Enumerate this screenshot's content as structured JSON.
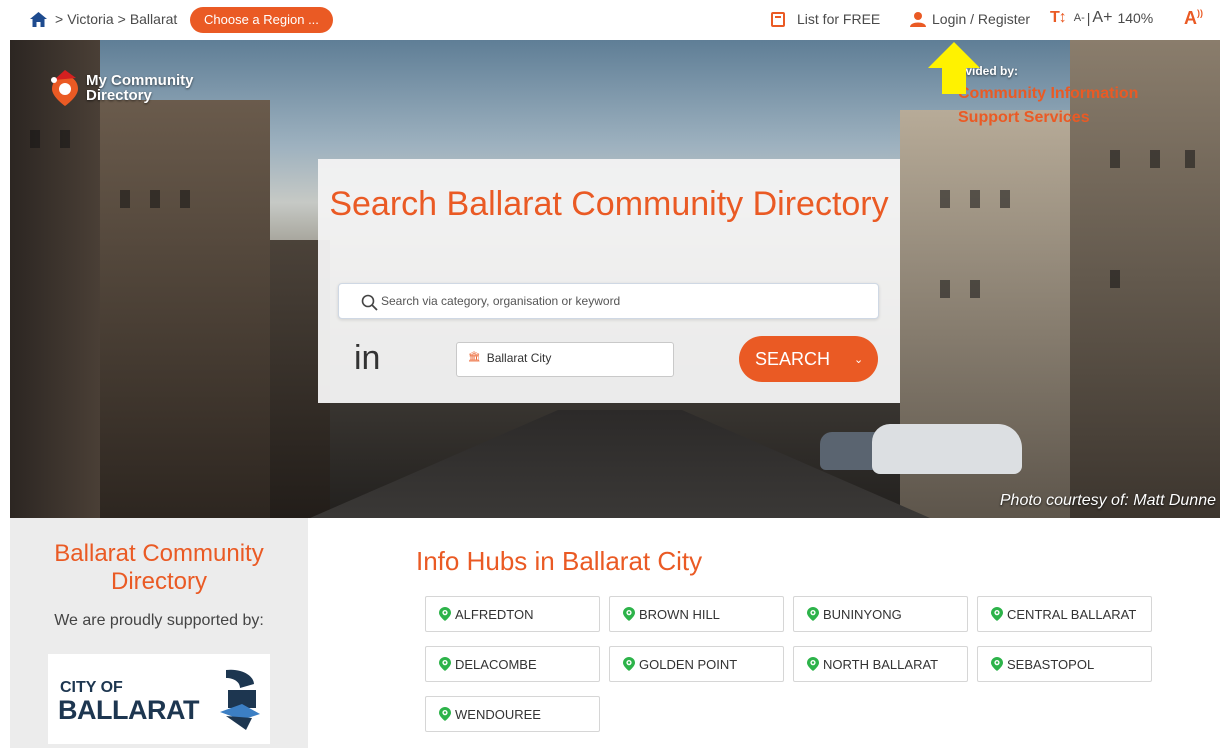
{
  "topbar": {
    "breadcrumb": [
      "Victoria",
      "Ballarat"
    ],
    "breadcrumb_sep": ">",
    "region_button": "Choose a Region ...",
    "list_free": "List for FREE",
    "login": "Login / Register",
    "text_size": {
      "decrease": "A-",
      "divider": "|",
      "increase": "A+",
      "zoom": "140%"
    }
  },
  "hero": {
    "logo_line1": "My Community",
    "logo_line2": "Directory",
    "provided_by": "ovided by:",
    "provider_name": "Community Information Support Services",
    "photo_credit": "Photo courtesy of: Matt Dunne"
  },
  "search": {
    "title": "Search Ballarat Community Directory",
    "placeholder": "Search via category, organisation or keyword",
    "in_label": "in",
    "location": "Ballarat City",
    "button": "SEARCH"
  },
  "side": {
    "title": "Ballarat Community Directory",
    "supported_by": "We are proudly supported by:",
    "sponsor_line1": "CITY OF",
    "sponsor_line2": "BALLARAT"
  },
  "hubs": {
    "title": "Info Hubs in Ballarat City",
    "items": [
      "ALFREDTON",
      "BROWN HILL",
      "BUNINYONG",
      "CENTRAL BALLARAT",
      "DELACOMBE",
      "GOLDEN POINT",
      "NORTH BALLARAT",
      "SEBASTOPOL",
      "WENDOUREE"
    ]
  },
  "colors": {
    "accent": "#ea5a24",
    "hub_pin": "#2db34a",
    "arrow": "#fff200"
  }
}
